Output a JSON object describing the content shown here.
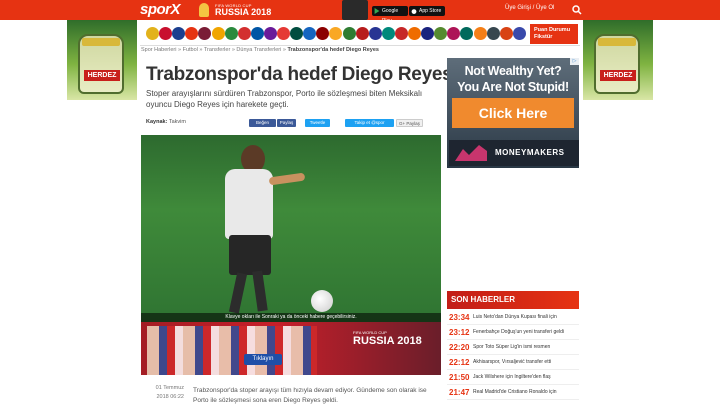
{
  "header": {
    "logo": "spor",
    "logo_mark": "X",
    "wc_small": "FIFA WORLD CUP",
    "wc_big": "RUSSIA 2018",
    "google_play": "Google Play",
    "app_store": "App Store",
    "login": "Üye Girişi",
    "separator": " / ",
    "signup": "Üye Ol",
    "colors": {
      "brand": "#e63312"
    }
  },
  "side_ads": {
    "brand": "HERDEZ"
  },
  "team_bar": {
    "team_count": 29,
    "puan_label_1": "Puan Durumu",
    "puan_label_2": "Fikstür"
  },
  "breadcrumb": {
    "items": [
      "Spor Haberleri",
      "Futbol",
      "Transferler",
      "Dünya Transferleri"
    ],
    "current": "Trabzonspor'da hedef Diego Reyes",
    "separator": " » "
  },
  "article": {
    "title": "Trabzonspor'da hedef Diego Reyes",
    "summary": "Stoper arayışlarını sürdüren Trabzonspor, Porto ile sözleşmesi biten Meksikalı oyuncu Diego Reyes için harekete geçti.",
    "source_label": "Kaynak:",
    "source_value": "Takvim",
    "share": {
      "fb_like": "Beğen",
      "fb_share": "Paylaş",
      "tweet": "Tweetle",
      "follow": "Takip et @spor",
      "gplus": "G+ Paylaş"
    },
    "image_caption": "Klavye okları ile Sonraki ya da önceki habere geçebilirsiniz.",
    "date": "01 Temmuz",
    "time": "2018 06:22",
    "body": "Trabzonspor'da stoper arayışı tüm hızıyla devam ediyor. Gündeme son olarak ise Porto ile sözleşmesi sona eren Diego Reyes geldi."
  },
  "promo_banner": {
    "wc_small": "FIFA WORLD CUP",
    "wc_big": "RUSSIA 2018",
    "button": "Tıklayın"
  },
  "sidebar_ad": {
    "headline_1": "Not Wealthy Yet?",
    "headline_2": "You Are Not Stupid!",
    "button": "Click Here",
    "brand": "MONEYMAKERS",
    "adchoice": "▷"
  },
  "news": {
    "header": "SON HABERLER",
    "items": [
      {
        "time": "23:34",
        "text": "Luis Neto'dan Dünya Kupası finali için"
      },
      {
        "time": "23:12",
        "text": "Fenerbahçe Doğuş'un yeni transferi geldi"
      },
      {
        "time": "22:20",
        "text": "Spor Toto Süper Lig'in ismi resmen"
      },
      {
        "time": "22:12",
        "text": "Akhisarspor, Vırsaljević transfer etti"
      },
      {
        "time": "21:50",
        "text": "Jack Wilshere için İngiltere'den flaş"
      },
      {
        "time": "21:47",
        "text": "Real Madrid'de Cristiano Ronaldo için"
      }
    ]
  }
}
